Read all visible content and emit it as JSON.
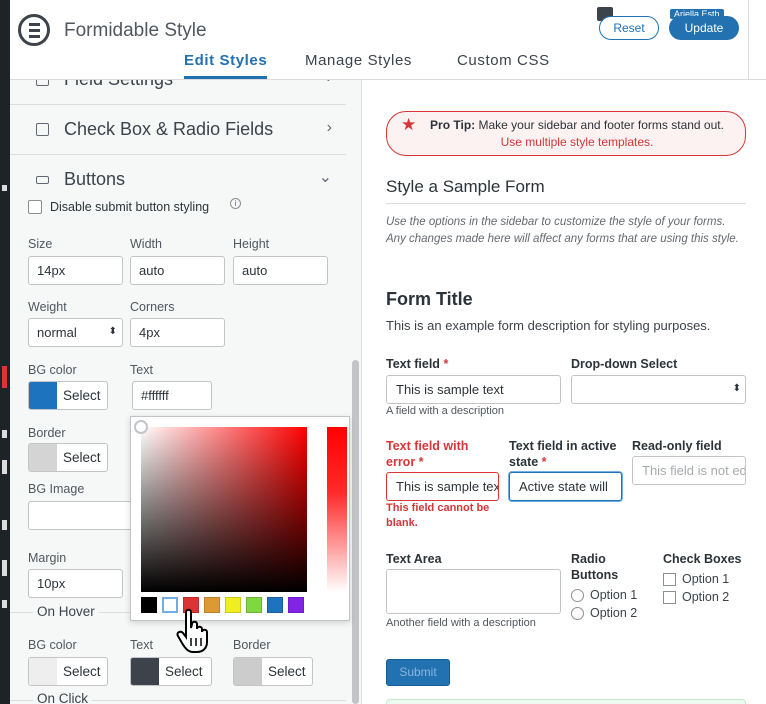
{
  "app": {
    "title": "Formidable Style",
    "logo_letter": "F"
  },
  "tabs": [
    {
      "label": "Edit Styles",
      "active": true
    },
    {
      "label": "Manage Styles",
      "active": false
    },
    {
      "label": "Custom CSS",
      "active": false
    }
  ],
  "header": {
    "reset_label": "Reset",
    "update_label": "Update",
    "user_name": "Ariella Esth",
    "notification_icon": "comment-icon"
  },
  "sidebar": {
    "sections": {
      "field_settings": "Field Settings",
      "checkbox_radio": "Check Box & Radio Fields",
      "buttons": "Buttons"
    },
    "buttons": {
      "disable_submit_label": "Disable submit button styling",
      "size_label": "Size",
      "size_value": "14px",
      "width_label": "Width",
      "width_value": "auto",
      "height_label": "Height",
      "height_value": "auto",
      "weight_label": "Weight",
      "weight_value": "normal",
      "corners_label": "Corners",
      "corners_value": "4px",
      "bg_color_label": "BG color",
      "bg_color_select": "Select",
      "text_label": "Text",
      "text_value": "#ffffff",
      "border_label": "Border",
      "border_select": "Select",
      "bg_image_label": "BG Image",
      "margin_label": "Margin",
      "margin_value": "10px",
      "on_hover_label": "On Hover",
      "hover_bg_label": "BG color",
      "hover_bg_select": "Select",
      "hover_text_label": "Text",
      "hover_text_select": "Select",
      "hover_border_label": "Border",
      "hover_border_select": "Select",
      "on_click_label": "On Click"
    },
    "colors": {
      "bg_color": "#1e73be",
      "border": "#d4d4d4",
      "hover_bg": "#eeeeee",
      "hover_text": "#3c434a",
      "hover_border": "#cccccc"
    },
    "palette": [
      "#000000",
      "#ffffff",
      "#dd3333",
      "#dd9933",
      "#eeee22",
      "#81d742",
      "#1e73be",
      "#8224e3"
    ]
  },
  "content": {
    "protip_bold": "Pro Tip:",
    "protip_text": " Make your sidebar and footer forms stand out. ",
    "protip_link": "Use multiple style templates.",
    "sample_heading": "Style a Sample Form",
    "sample_desc": "Use the options in the sidebar to customize the style of your forms. Any changes made here will affect any forms that are using this style.",
    "form_title": "Form Title",
    "form_desc": "This is an example form description for styling purposes.",
    "fields": {
      "text_label": "Text field",
      "text_value": "This is sample text",
      "text_help": "A field with a description",
      "dropdown_label": "Drop-down Select",
      "error_label": "Text field with error",
      "error_value": "This is sample text",
      "error_msg": "This field cannot be blank.",
      "active_label": "Text field in active state",
      "active_value": "Active state will",
      "readonly_label": "Read-only field",
      "readonly_placeholder": "This field is not editable",
      "textarea_label": "Text Area",
      "textarea_help": "Another field with a description",
      "radio_label": "Radio Buttons",
      "radio_opt1": "Option 1",
      "radio_opt2": "Option 2",
      "check_label": "Check Boxes",
      "check_opt1": "Option 1",
      "check_opt2": "Option 2",
      "required_mark": "*",
      "submit_label": "Submit"
    }
  }
}
